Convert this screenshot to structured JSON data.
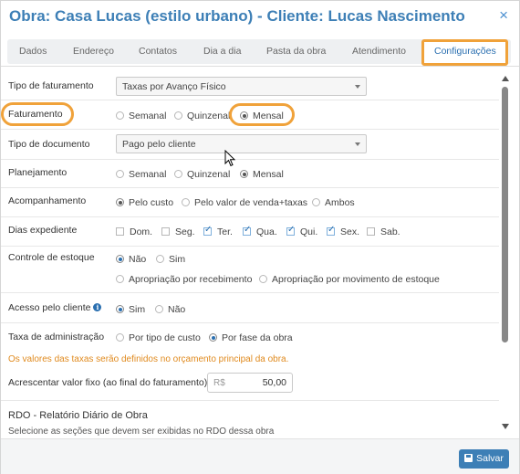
{
  "header": {
    "title": "Obra: Casa Lucas (estilo urbano) - Cliente: Lucas Nascimento",
    "close_glyph": "×"
  },
  "tabs": [
    {
      "label": "Dados"
    },
    {
      "label": "Endereço"
    },
    {
      "label": "Contatos"
    },
    {
      "label": "Dia a dia"
    },
    {
      "label": "Pasta da obra"
    },
    {
      "label": "Atendimento"
    },
    {
      "label": "Configurações",
      "active": true
    }
  ],
  "form": {
    "tipo_faturamento": {
      "label": "Tipo de faturamento",
      "value": "Taxas por Avanço Físico"
    },
    "faturamento": {
      "label": "Faturamento",
      "options": [
        "Semanal",
        "Quinzenal",
        "Mensal"
      ],
      "selected": "Mensal"
    },
    "tipo_documento": {
      "label": "Tipo de documento",
      "value": "Pago pelo cliente"
    },
    "planejamento": {
      "label": "Planejamento",
      "options": [
        "Semanal",
        "Quinzenal",
        "Mensal"
      ],
      "selected": "Mensal"
    },
    "acompanhamento": {
      "label": "Acompanhamento",
      "options": [
        "Pelo custo",
        "Pelo valor de venda+taxas",
        "Ambos"
      ],
      "selected": "Pelo custo"
    },
    "dias_expediente": {
      "label": "Dias expediente",
      "days": [
        {
          "label": "Dom.",
          "checked": false
        },
        {
          "label": "Seg.",
          "checked": false
        },
        {
          "label": "Ter.",
          "checked": true
        },
        {
          "label": "Qua.",
          "checked": true
        },
        {
          "label": "Qui.",
          "checked": true
        },
        {
          "label": "Sex.",
          "checked": true
        },
        {
          "label": "Sab.",
          "checked": false
        }
      ]
    },
    "controle_estoque": {
      "label": "Controle de estoque",
      "options": [
        "Não",
        "Sim"
      ],
      "selected": "Não",
      "sub_options": [
        "Apropriação por recebimento",
        "Apropriação por movimento de estoque"
      ]
    },
    "acesso_cliente": {
      "label": "Acesso pelo cliente",
      "info_glyph": "i",
      "options": [
        "Sim",
        "Não"
      ],
      "selected": "Sim"
    },
    "taxa_adm": {
      "label": "Taxa de administração",
      "options": [
        "Por tipo de custo",
        "Por fase da obra"
      ],
      "selected": "Por fase da obra"
    },
    "taxa_note": "Os valores das taxas serão definidos no orçamento principal da obra.",
    "valor_fixo": {
      "label": "Acrescentar valor fixo (ao final do faturamento)",
      "currency": "R$",
      "value": "50,00"
    },
    "rdo": {
      "title": "RDO - Relatório Diário de Obra",
      "subtitle": "Selecione as seções que devem ser exibidas no RDO dessa obra"
    }
  },
  "footer": {
    "save_label": "Salvar"
  },
  "colors": {
    "accent": "#3d7fb6",
    "highlight": "#f0a23a",
    "note": "#e08a1e"
  }
}
